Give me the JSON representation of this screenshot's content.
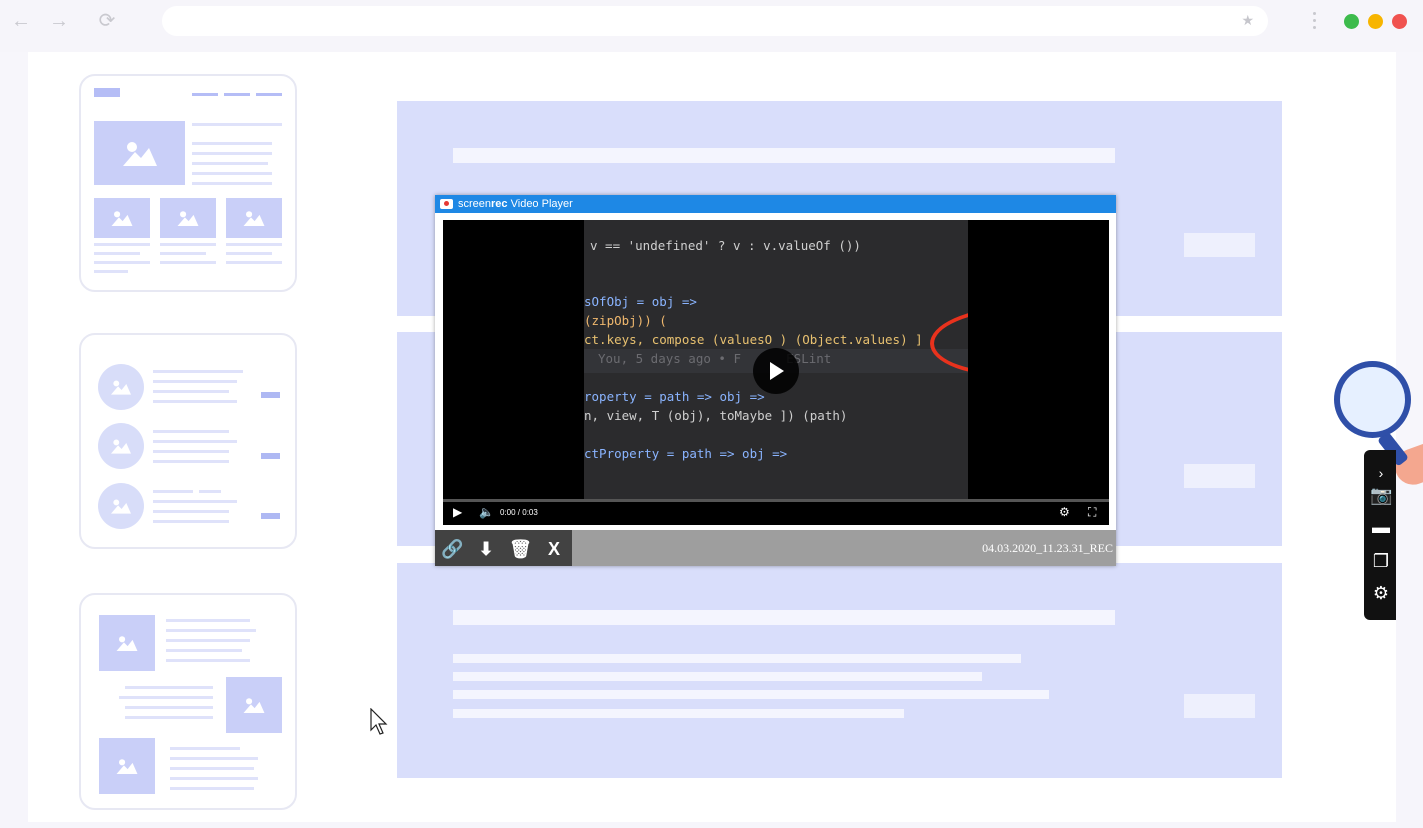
{
  "browser": {
    "back_icon": "arrow-left-icon",
    "forward_icon": "arrow-right-icon",
    "reload_icon": "reload-icon",
    "bookmark_icon": "star-icon",
    "menu_icon": "kebab-menu-icon",
    "traffic_lights": [
      "#3dbb4c",
      "#f7b500",
      "#f0524f"
    ]
  },
  "player": {
    "title_brand_light": "screen",
    "title_brand_bold": "rec",
    "title_suffix": " Video Player",
    "code_lines": [
      {
        "t": "v == 'undefined' ? v : v.valueOf ())",
        "x": 6
      },
      {
        "t": "sOfObj = obj =>",
        "x": 0
      },
      {
        "t": "(zipObj)) (",
        "x": 0
      },
      {
        "t": "ct.keys, compose (valuesO ) (Object.values) ]",
        "x": 0
      },
      {
        "t": "You, 5 days ago • F      ESLint",
        "x": 14
      },
      {
        "t": "roperty = path => obj =>",
        "x": 0
      },
      {
        "t": "n, view, T (obj), toMaybe ]) (path)",
        "x": 0
      },
      {
        "t": "ctProperty = path => obj =>",
        "x": 0
      }
    ],
    "time": "0:00 / 0:03",
    "progress": 0.0,
    "filename": "04.03.2020_11.23.31_REC"
  },
  "accent": "#1e88e5",
  "highlight": "#e8321d"
}
